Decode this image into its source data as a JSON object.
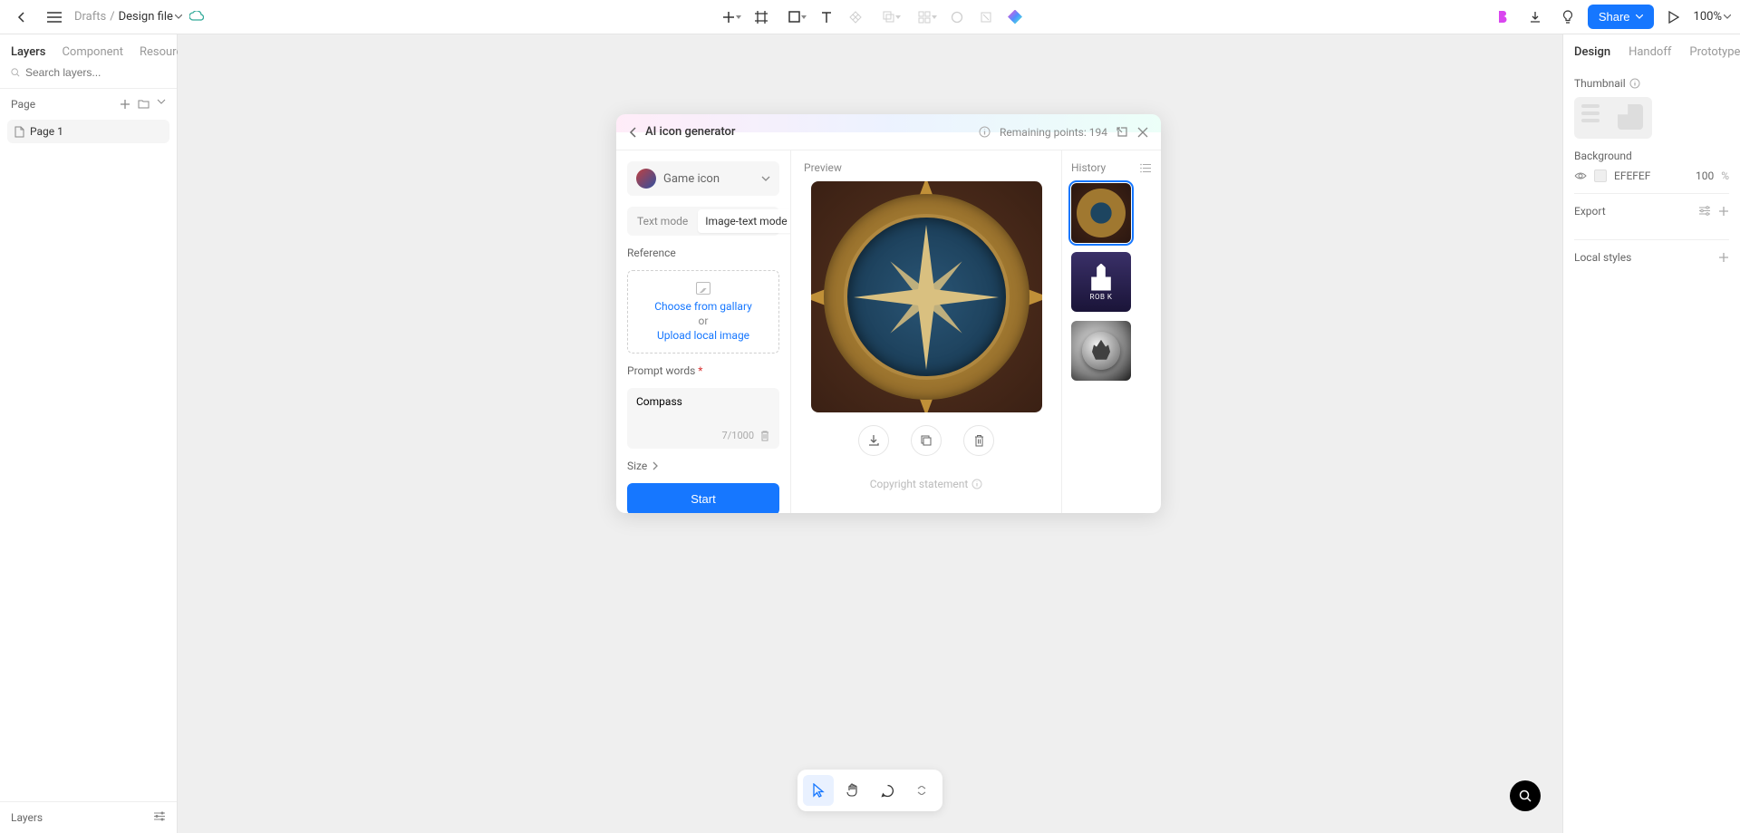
{
  "breadcrumb": {
    "drafts": "Drafts",
    "file": "Design file"
  },
  "leftPanel": {
    "tabs": {
      "layers": "Layers",
      "component": "Component",
      "resource": "Resource"
    },
    "searchPlaceholder": "Search layers...",
    "pageHeading": "Page",
    "page1": "Page 1",
    "layersHeading": "Layers"
  },
  "rightPanel": {
    "tabs": {
      "design": "Design",
      "handoff": "Handoff",
      "prototype": "Prototype"
    },
    "thumbnail": "Thumbnail",
    "background": "Background",
    "bgHex": "EFEFEF",
    "bgOpacity": "100",
    "bgUnit": "%",
    "export": "Export",
    "localStyles": "Local styles"
  },
  "zoom": "100%",
  "shareLabel": "Share",
  "modal": {
    "title": "AI icon generator",
    "pointsLabel": "Remaining points: 194",
    "styleLabel": "Game icon",
    "modeText": "Text mode",
    "modeImageText": "Image-text mode",
    "referenceLabel": "Reference",
    "chooseGallery": "Choose from gallary",
    "or": "or",
    "uploadLocal": "Upload local image",
    "promptLabel": "Prompt words",
    "promptValue": "Compass",
    "promptCount": "7/1000",
    "sizeLabel": "Size",
    "startLabel": "Start",
    "previewLabel": "Preview",
    "copyright": "Copyright statement",
    "historyLabel": "History",
    "hist2label": "ROB K"
  }
}
